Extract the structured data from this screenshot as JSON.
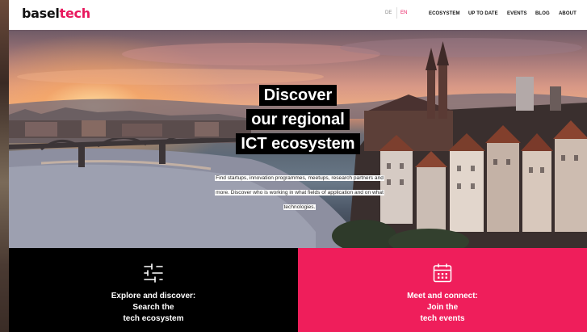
{
  "header": {
    "logo_part1": "basel",
    "logo_part2": "tech",
    "lang_de": "DE",
    "lang_en": "EN",
    "nav": [
      "ECOSYSTEM",
      "UP TO DATE",
      "EVENTS",
      "BLOG",
      "ABOUT"
    ]
  },
  "hero": {
    "title_lines": [
      "Discover",
      "our regional",
      "ICT ecosystem"
    ],
    "description": "Find startups, innovation programmes, meetups, research partners and more. Discover who is working in what fields of application and on what technologies."
  },
  "cards": {
    "explore": {
      "icon": "sliders-icon",
      "title_lines": [
        "Explore and discover:",
        "Search the",
        "tech ecosystem"
      ]
    },
    "events": {
      "icon": "calendar-icon",
      "title_lines": [
        "Meet and connect:",
        "Join the",
        "tech events"
      ]
    }
  },
  "colors": {
    "brand_pink": "#e8175d",
    "card_pink": "#ef1e5b",
    "card_black": "#000000"
  }
}
